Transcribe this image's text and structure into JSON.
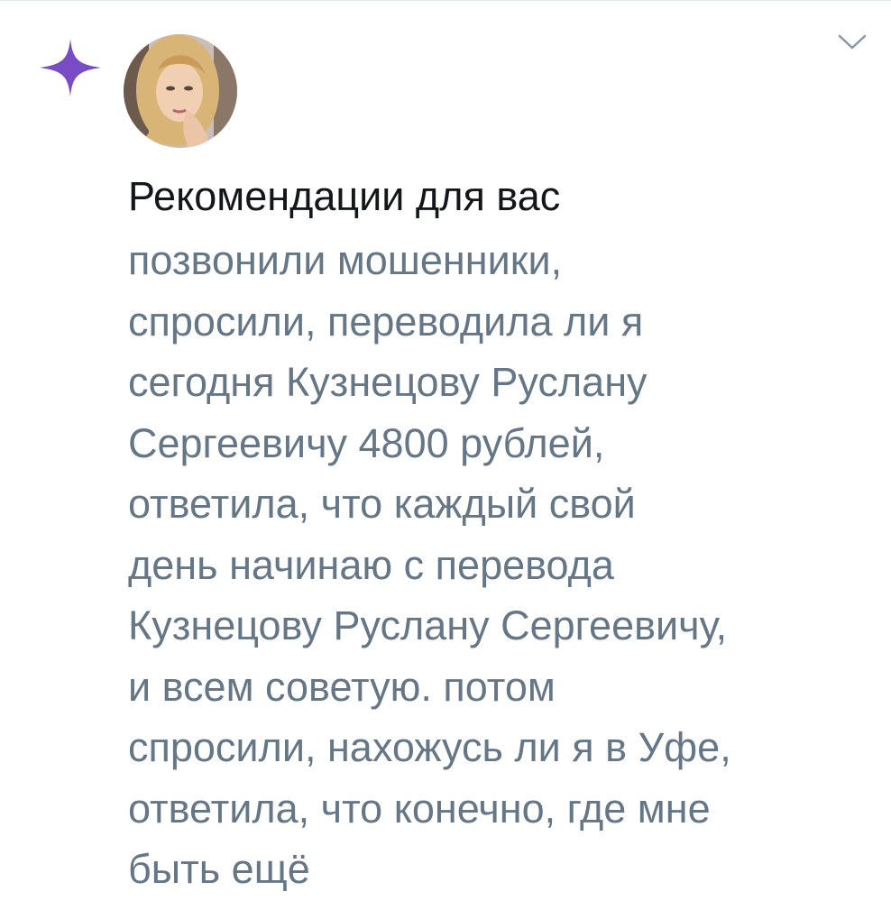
{
  "tweet": {
    "icons": {
      "sparkle": "sparkle-icon",
      "chevron": "chevron-down-icon",
      "accent_color": "#794bc4"
    },
    "headline": "Рекомендации для вас",
    "body_lines": [
      "позвонили мошенники,",
      "спросили, переводила ли я",
      "сегодня Кузнецову Руслану",
      "Сергеевичу 4800 рублей,",
      "ответила, что каждый свой",
      "день начинаю с перевода",
      "Кузнецову Руслану Сергеевичу,",
      "и всем советую. потом",
      "спросили, нахожусь ли я в Уфе,",
      "ответила, что конечно, где мне",
      "быть ещё"
    ]
  }
}
